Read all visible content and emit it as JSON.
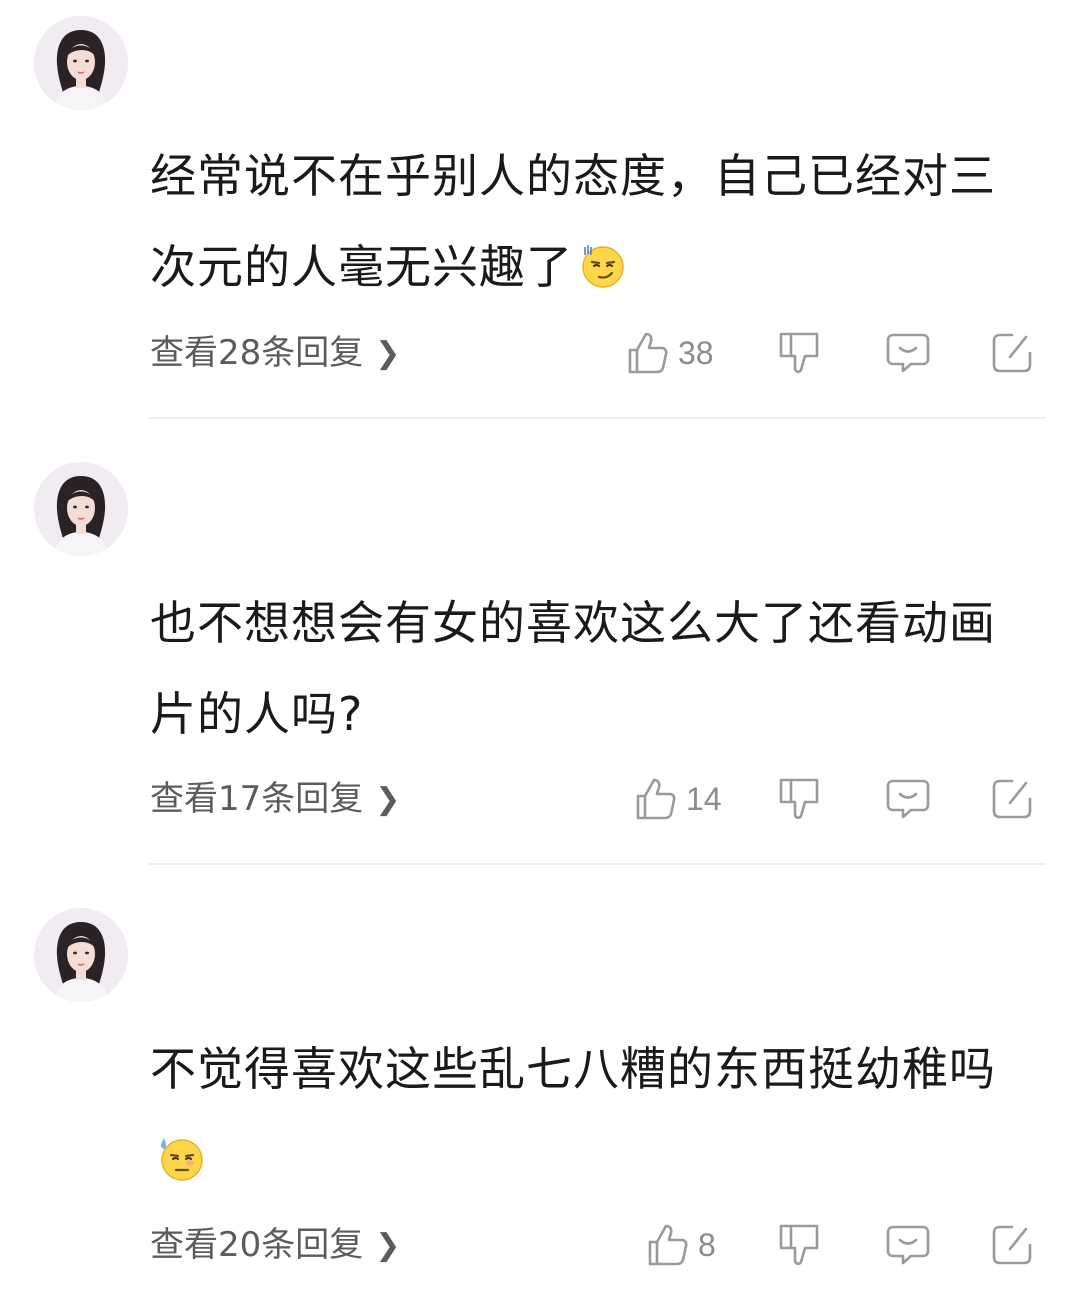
{
  "comments": [
    {
      "username": "",
      "text": "经常说不在乎别人的态度，自己已经对三次元的人毫无兴趣了",
      "emoji": "smirk-emoji-icon",
      "replies_label": "查看28条回复",
      "likes": "38"
    },
    {
      "username": "",
      "text": "也不想想会有女的喜欢这么大了还看动画片的人吗?",
      "emoji": "",
      "replies_label": "查看17条回复",
      "likes": "14"
    },
    {
      "username": "",
      "text": "不觉得喜欢这些乱七八糟的东西挺幼稚吗",
      "emoji": "sweat-emoji-icon",
      "replies_label": "查看20条回复",
      "likes": "8"
    }
  ],
  "icons": {
    "like": "thumb-up-icon",
    "dislike": "thumb-down-icon",
    "reply": "comment-bubble-icon",
    "share": "edit-share-icon",
    "chevron": "chevron-right-icon"
  },
  "colors": {
    "text": "#1a1a1a",
    "secondary": "#5c5c5c",
    "icon": "#9a9a9a",
    "divider": "#efefef"
  }
}
